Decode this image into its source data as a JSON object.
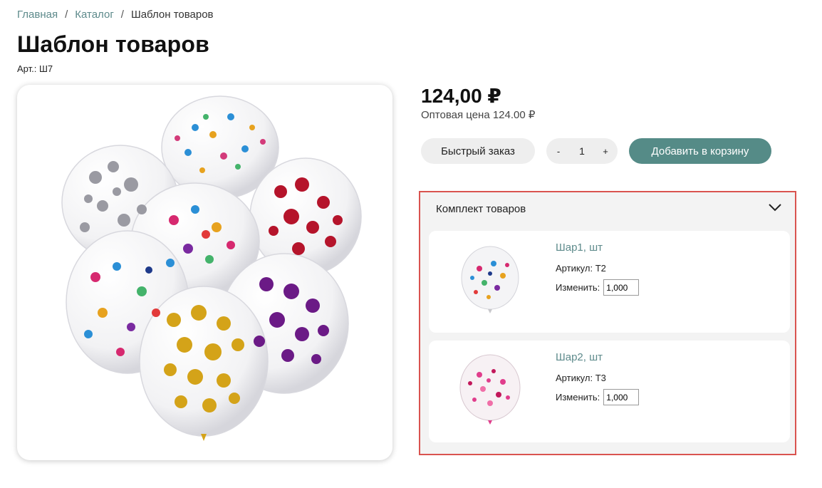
{
  "breadcrumb": {
    "home": "Главная",
    "sep1": "/",
    "catalog": "Каталог",
    "sep2": "/",
    "current": "Шаблон товаров"
  },
  "product": {
    "title": "Шаблон товаров",
    "sku": "Арт.: Ш7",
    "price": "124,00 ₽",
    "wholesale": "Оптовая цена 124.00 ₽"
  },
  "actions": {
    "quick_order": "Быстрый заказ",
    "minus": "-",
    "quantity": "1",
    "plus": "+",
    "add_to_cart": "Добавить в корзину"
  },
  "bundle": {
    "title": "Комплект товаров",
    "items": [
      {
        "name": "Шар1, шт",
        "article": "Артикул: Т2",
        "change_label": "Изменить:",
        "value": "1,000"
      },
      {
        "name": "Шар2, шт",
        "article": "Артикул: Т3",
        "change_label": "Изменить:",
        "value": "1,000"
      }
    ]
  },
  "colors": {
    "accent": "#558b87",
    "link": "#5d8a8b",
    "highlight_border": "#d9534f"
  }
}
